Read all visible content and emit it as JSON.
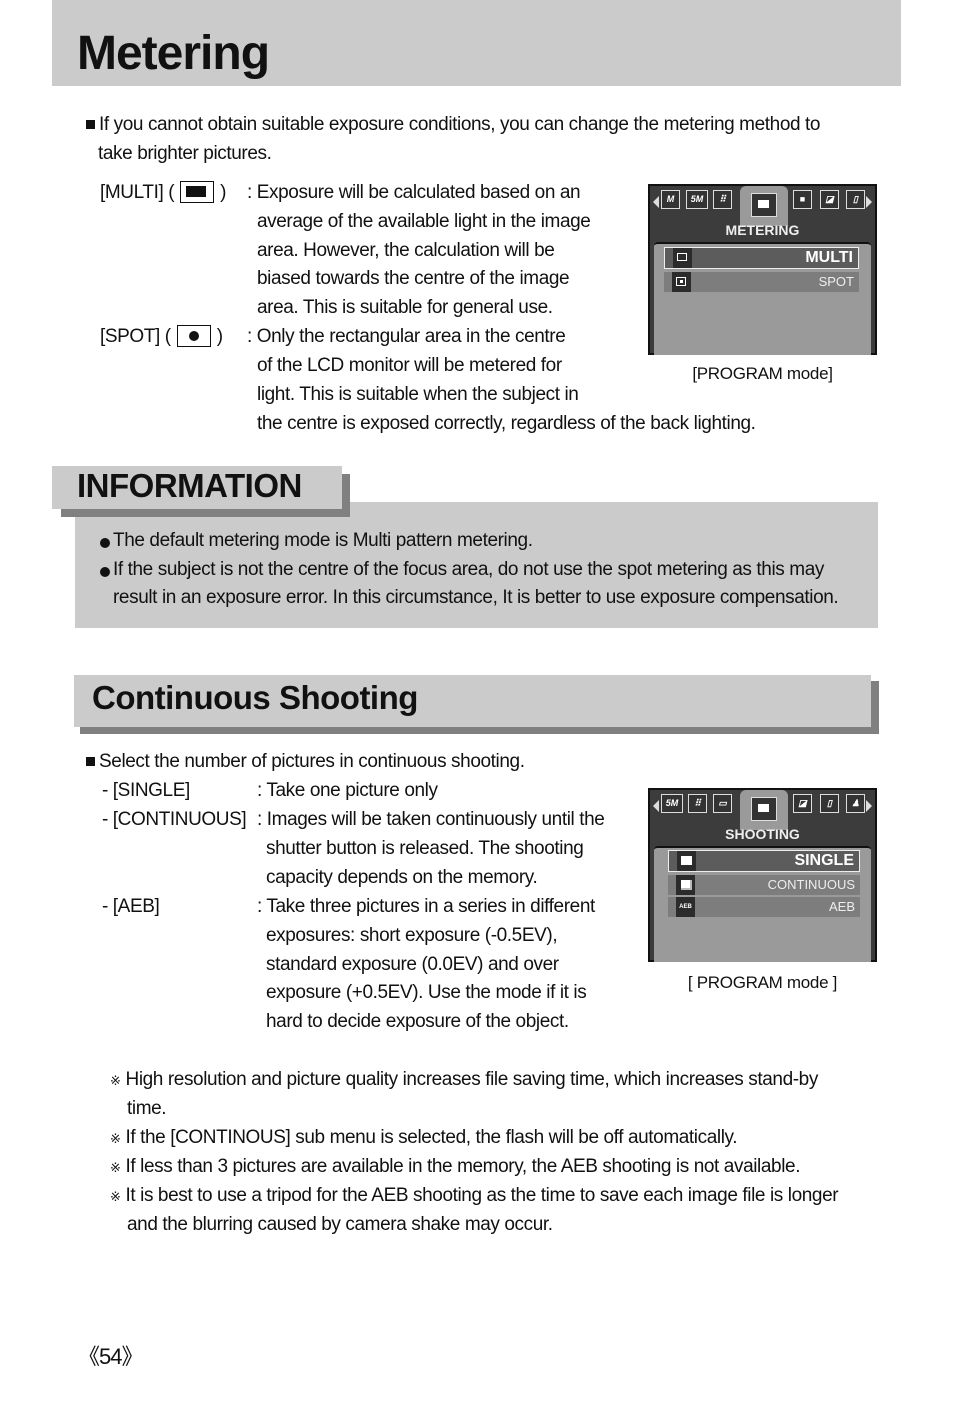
{
  "page": {
    "title": "Metering",
    "page_number": "《54》"
  },
  "metering": {
    "intro_line1": "If you cannot obtain suitable exposure conditions, you can change the metering method to",
    "intro_line2": "take brighter pictures.",
    "multi": {
      "label_open": "[MULTI] (",
      "label_close": ")",
      "icon": "multi-metering-icon",
      "desc": [
        ": Exposure will be calculated based on an",
        "average of the available light in the image",
        "area. However, the calculation will be",
        "biased towards the centre of the image",
        "area. This is suitable for general use."
      ]
    },
    "spot": {
      "label_open": "[SPOT] (",
      "label_close": ")",
      "icon": "spot-metering-icon",
      "desc": [
        ": Only the rectangular area in the centre",
        "of the LCD monitor will be metered for",
        "light. This is suitable when the subject in",
        "the centre is exposed correctly, regardless of the back lighting."
      ]
    },
    "lcd": {
      "tabs": [
        "M",
        "5M",
        "quality-icon",
        "metering-icon",
        "shooting-icon",
        "sharpness-icon",
        "effect-icon"
      ],
      "menu_title": "METERING",
      "options": [
        {
          "label": "MULTI",
          "selected": true
        },
        {
          "label": "SPOT",
          "selected": false
        }
      ],
      "caption": "[PROGRAM mode]"
    }
  },
  "information": {
    "heading": "INFORMATION",
    "bullets": [
      {
        "lines": [
          "The default metering mode is Multi pattern metering."
        ]
      },
      {
        "lines": [
          "If the subject is not the centre of the focus area, do not use the spot metering as this may",
          "result in an exposure error. In this circumstance, It is better to use exposure compensation."
        ]
      }
    ]
  },
  "continuous": {
    "heading": "Continuous Shooting",
    "intro": "Select the number of pictures in continuous shooting.",
    "items": [
      {
        "label": "- [SINGLE]",
        "desc": [
          ": Take one picture only"
        ]
      },
      {
        "label": "- [CONTINUOUS]",
        "desc": [
          ": Images will be taken continuously until the",
          "shutter button is released. The shooting",
          "capacity depends on the memory."
        ]
      },
      {
        "label": "- [AEB]",
        "desc": [
          ": Take three pictures in a series in different",
          "exposures: short exposure (-0.5EV),",
          "standard exposure (0.0EV) and over",
          "exposure (+0.5EV). Use the mode if it is",
          "hard to decide exposure of the object."
        ]
      }
    ],
    "lcd": {
      "tabs": [
        "5M",
        "quality-icon",
        "metering-icon",
        "shooting-icon",
        "sharpness-icon",
        "effect-icon",
        "self-timer-icon"
      ],
      "menu_title": "SHOOTING",
      "options": [
        {
          "label": "SINGLE",
          "selected": true
        },
        {
          "label": "CONTINUOUS",
          "selected": false
        },
        {
          "label": "AEB",
          "selected": false,
          "icon_text": "AEB"
        }
      ],
      "caption": "[ PROGRAM mode ]"
    },
    "notes": [
      {
        "lines": [
          "High resolution and picture quality increases file saving time, which increases stand-by",
          "time."
        ]
      },
      {
        "lines": [
          "If the [CONTINOUS] sub menu is selected, the flash will be off automatically."
        ]
      },
      {
        "lines": [
          "If less than 3 pictures are available in the memory, the AEB shooting is not available."
        ]
      },
      {
        "lines": [
          "It is best to use a tripod for the AEB shooting as the time to save each image file is longer",
          "and the blurring caused by camera shake may occur."
        ]
      }
    ]
  }
}
